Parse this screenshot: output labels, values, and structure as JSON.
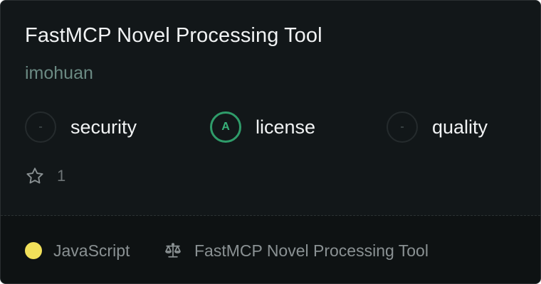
{
  "card": {
    "title": "FastMCP Novel Processing Tool",
    "author": "imohuan"
  },
  "scores": [
    {
      "grade": "-",
      "label": "security",
      "status": "none"
    },
    {
      "grade": "A",
      "label": "license",
      "status": "good"
    },
    {
      "grade": "-",
      "label": "quality",
      "status": "none"
    }
  ],
  "stars": {
    "icon": "star-icon",
    "count": "1"
  },
  "footer": {
    "language": "JavaScript",
    "language_color": "#f1e05a",
    "license_icon": "scale-icon",
    "license_name": "FastMCP Novel Processing Tool"
  },
  "colors": {
    "background": "#121719",
    "footer_background": "#0e1213",
    "grade_good": "#2f9c6a",
    "author": "#6b8a83"
  }
}
